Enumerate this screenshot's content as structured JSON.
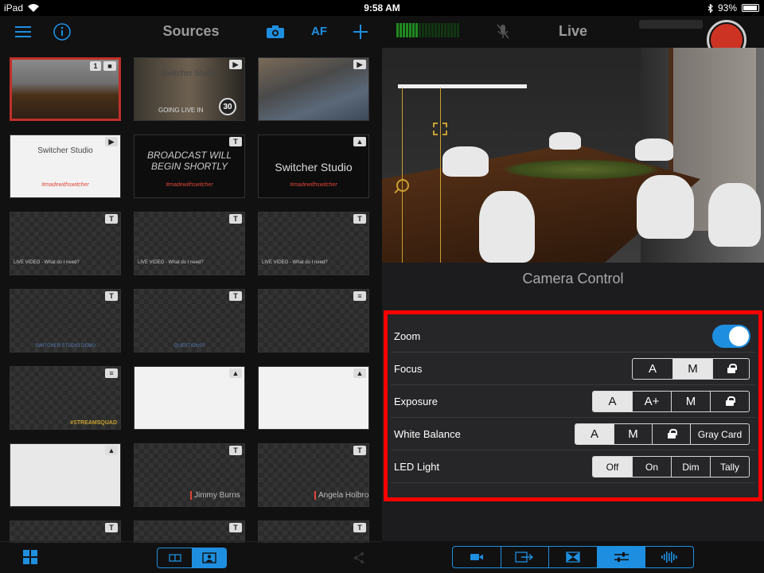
{
  "status_bar": {
    "device": "iPad",
    "time": "9:58 AM",
    "battery": "93%"
  },
  "sources": {
    "title": "Sources",
    "af_label": "AF",
    "thumbnails": [
      {
        "kind": "photo-room",
        "badge": "cam",
        "number": "1",
        "selected": true
      },
      {
        "kind": "photo-office",
        "badge": "play",
        "brand": "Switcher Studio",
        "caption": "GOING LIVE IN",
        "countdown": "30"
      },
      {
        "kind": "photo-city",
        "badge": "play"
      },
      {
        "kind": "white",
        "badge": "play",
        "brand": "Switcher Studio",
        "hashtag": "#madewithswitcher"
      },
      {
        "kind": "black",
        "badge": "T",
        "headline": "BROADCAST WILL BEGIN SHORTLY",
        "hashtag": "#madewithswitcher"
      },
      {
        "kind": "black",
        "badge": "img",
        "brand": "Switcher Studio",
        "hashtag": "#madewithswitcher"
      },
      {
        "kind": "checker",
        "badge": "T",
        "caption": "LIVE VIDEO - What do I need?"
      },
      {
        "kind": "checker",
        "badge": "T",
        "caption": "LIVE VIDEO - What do I need?"
      },
      {
        "kind": "checker",
        "badge": "T",
        "caption": "LIVE VIDEO - What do I need?"
      },
      {
        "kind": "checker",
        "badge": "T",
        "subcaption": "SWITCHER STUDIO DEMO"
      },
      {
        "kind": "checker",
        "badge": "T",
        "subcaption": "QUESTIONS?"
      },
      {
        "kind": "checker",
        "badge": "layers"
      },
      {
        "kind": "checker",
        "badge": "layers",
        "tag": "#STREAMSQUAD"
      },
      {
        "kind": "photo-device",
        "badge": "img"
      },
      {
        "kind": "photo-device",
        "badge": "img"
      },
      {
        "kind": "diagram",
        "badge": "img"
      },
      {
        "kind": "checker",
        "badge": "T",
        "lower_third": "Jimmy Burns"
      },
      {
        "kind": "checker",
        "badge": "T",
        "lower_third": "Angela Holbrook"
      },
      {
        "kind": "checker",
        "badge": "T"
      },
      {
        "kind": "checker",
        "badge": "T"
      },
      {
        "kind": "checker",
        "badge": "T"
      }
    ]
  },
  "live": {
    "title": "Live",
    "camera_control_title": "Camera Control",
    "controls": {
      "zoom": {
        "label": "Zoom",
        "enabled": true
      },
      "focus": {
        "label": "Focus",
        "options": [
          "A",
          "M",
          "lock"
        ],
        "selected": "M"
      },
      "exposure": {
        "label": "Exposure",
        "options": [
          "A",
          "A+",
          "M",
          "lock"
        ],
        "selected": "A"
      },
      "white_balance": {
        "label": "White Balance",
        "options": [
          "A",
          "M",
          "lock",
          "Gray Card"
        ],
        "selected": "A"
      },
      "led_light": {
        "label": "LED Light",
        "options": [
          "Off",
          "On",
          "Dim",
          "Tally"
        ],
        "selected": "Off"
      }
    }
  },
  "colors": {
    "accent": "#1e8fe0",
    "record": "#cc3323",
    "highlight": "#ff0000",
    "selection_border": "#c0302a"
  }
}
